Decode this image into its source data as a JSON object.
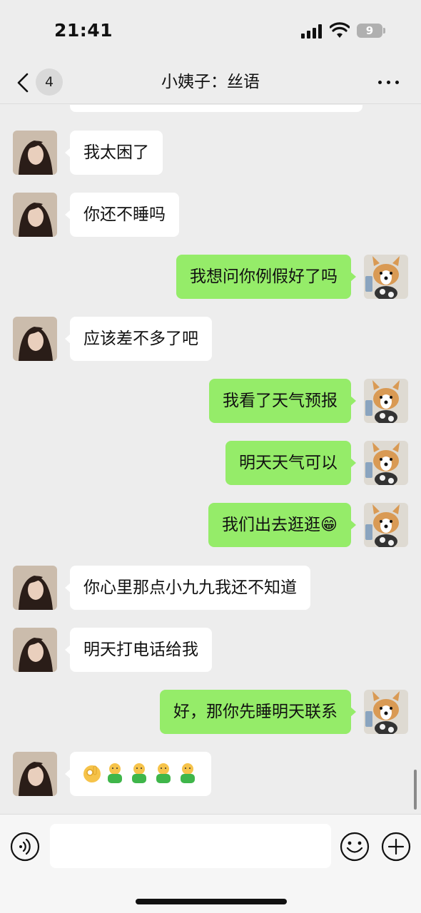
{
  "status_bar": {
    "time": "21:41",
    "battery_level": "9"
  },
  "nav": {
    "unread_count": "4",
    "title": "小姨子：丝语"
  },
  "messages": [
    {
      "side": "in",
      "text": "我太困了"
    },
    {
      "side": "in",
      "text": "你还不睡吗"
    },
    {
      "side": "out",
      "text": "我想问你例假好了吗"
    },
    {
      "side": "in",
      "text": "应该差不多了吧"
    },
    {
      "side": "out",
      "text": "我看了天气预报"
    },
    {
      "side": "out",
      "text": "明天天气可以"
    },
    {
      "side": "out",
      "text": "我们出去逛逛😁"
    },
    {
      "side": "in",
      "text": "你心里那点小九九我还不知道"
    },
    {
      "side": "in",
      "text": "明天打电话给我"
    },
    {
      "side": "out",
      "text": "好，那你先睡明天联系"
    },
    {
      "side": "in",
      "text": "👌🧑‍🧑‍🧑‍🧑‍"
    }
  ],
  "emoji_message": {
    "ok_hand": "👌",
    "hug_figure": "🫂"
  },
  "input": {
    "placeholder": "",
    "value": ""
  },
  "icons": {
    "back": "chevron-left-icon",
    "more": "more-dots-icon",
    "voice": "voice-icon",
    "emoji": "emoji-face-icon",
    "plus": "plus-icon",
    "contact_avatar": "avatar-woman-photo",
    "self_avatar": "avatar-corgi-photo"
  },
  "colors": {
    "outgoing_bubble": "#95ec69",
    "incoming_bubble": "#ffffff",
    "background": "#ededed"
  }
}
